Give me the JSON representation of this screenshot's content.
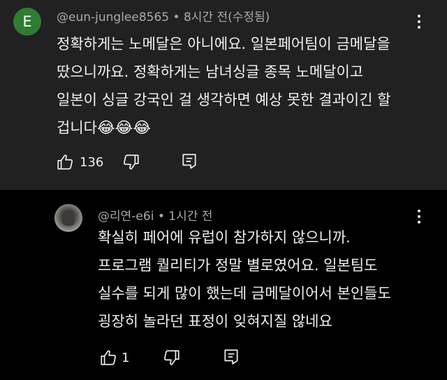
{
  "comments": [
    {
      "avatar_letter": "E",
      "avatar_color": "#2e7d32",
      "author": "@eun-junglee8565",
      "separator": "•",
      "time": "8시간 전(수정됨)",
      "lines": [
        "정확하게는 노메달은 아니에요. 일본페어팀이 금메달을",
        "땄으니까요. 정확하게는 남녀싱글 종목 노메달이고",
        "일본이 싱글 강국인 걸 생각하면 예상 못한 결과이긴 할",
        "겁니다"
      ],
      "emoji": "😂😂😂",
      "likes": "136"
    },
    {
      "author": "@리연-e6i",
      "separator": "•",
      "time": "1시간 전",
      "lines": [
        "확실히 페어에 유럽이 참가하지 않으니까.",
        "프로그램 퀄리티가 정말 별로였어요. 일본팀도",
        "실수를 되게 많이 했는데 금메달이어서 본인들도",
        "굉장히 놀라던 표정이 잊혀지질 않네요"
      ],
      "likes": "1"
    }
  ],
  "colors": {
    "top_background": "#212121",
    "bottom_background": "#000000",
    "text": "#f1f1f1",
    "meta_text": "#aaaaaa"
  }
}
